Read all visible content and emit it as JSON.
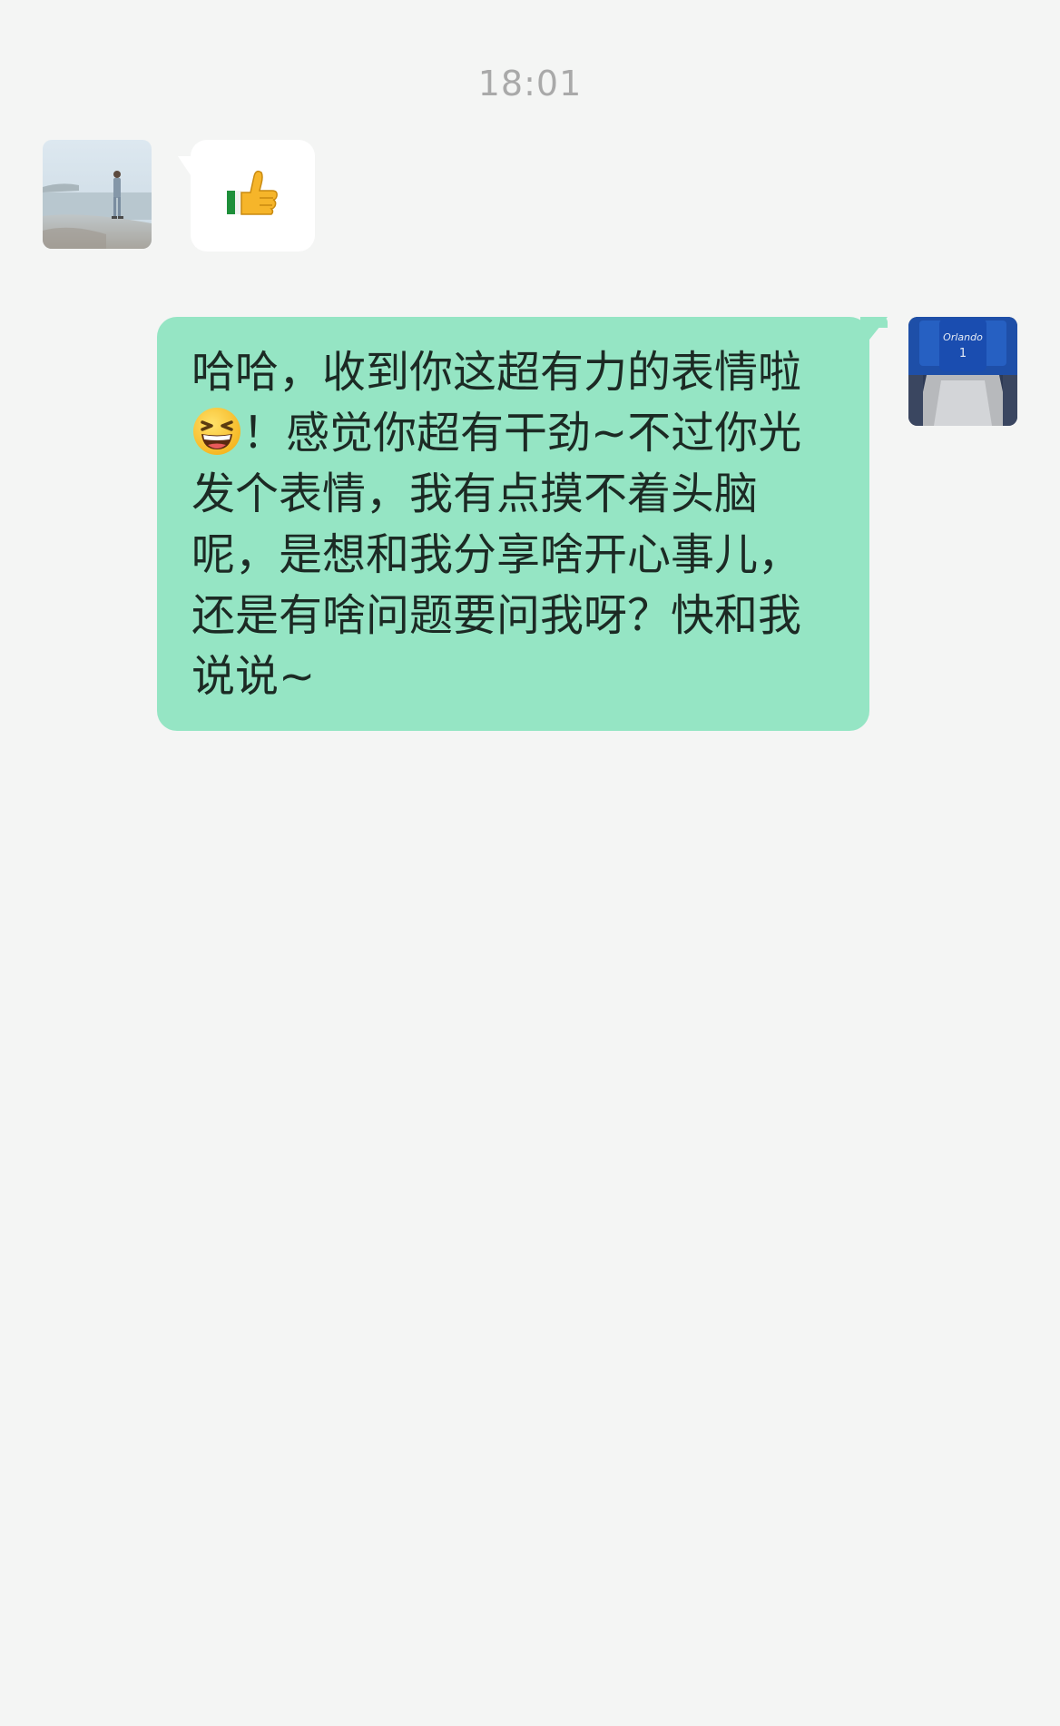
{
  "chat": {
    "timestamp": "18:01",
    "messages": [
      {
        "sender": "other",
        "type": "sticker",
        "sticker_icon": "thumbs-up-icon"
      },
      {
        "sender": "self",
        "type": "text",
        "line1": "哈哈，收到你这超有力的表情啦",
        "line2_after_emoji": "！感觉你超有干劲~不过你光",
        "line3": "发个表情，我有点摸不着头脑",
        "line4": "呢，是想和我分享啥开心事儿，",
        "line5": "还是有啥问题要问我呀？快和我",
        "line6": "说说~",
        "emoji": "grinning-squinting-face-icon"
      }
    ]
  },
  "colors": {
    "background": "#F4F5F4",
    "self_bubble": "#95E5C4",
    "other_bubble": "#FFFFFF",
    "timestamp_text": "#A9A9A9"
  }
}
